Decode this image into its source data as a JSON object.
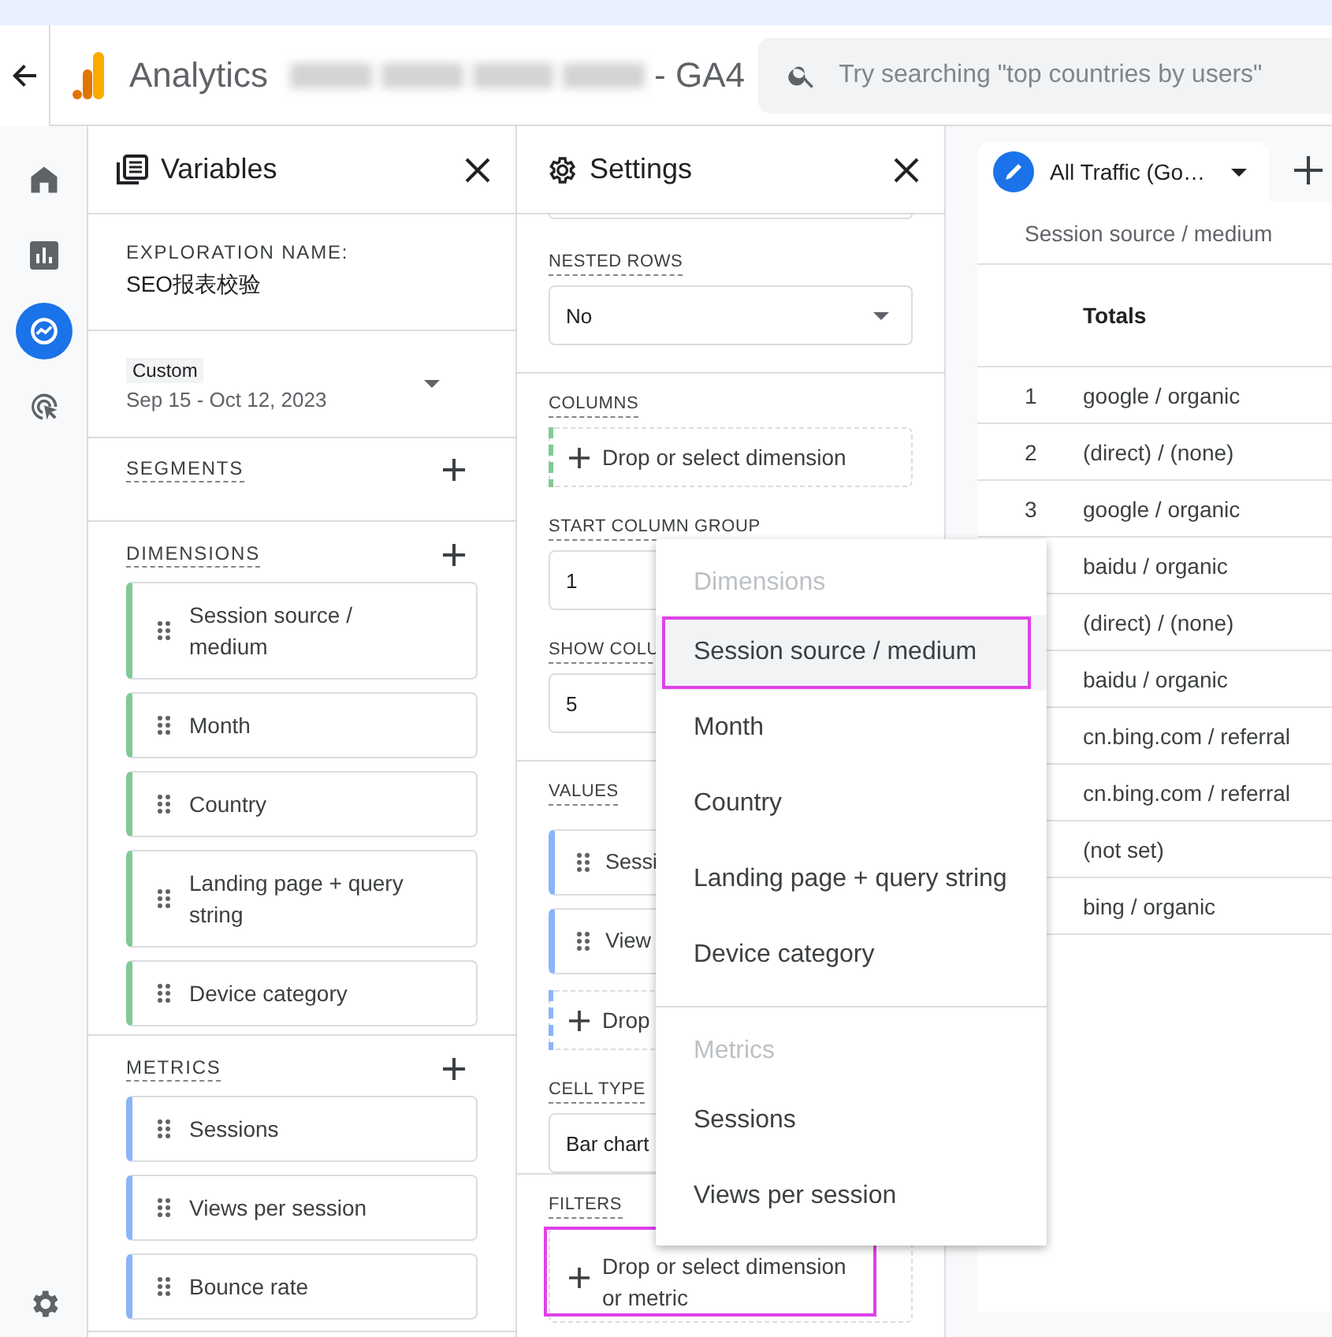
{
  "top_bar": {
    "app_name": "Analytics",
    "property_suffix": "- GA4",
    "search": {
      "placeholder": "Try searching \"top countries by users\""
    }
  },
  "nav_rail": [
    {
      "kind": "home",
      "selected": false
    },
    {
      "kind": "reports",
      "selected": false
    },
    {
      "kind": "explore",
      "selected": true
    },
    {
      "kind": "advertising",
      "selected": false
    }
  ],
  "variables": {
    "title": "Variables",
    "exploration_name_label": "EXPLORATION NAME:",
    "exploration_name": "SEO报表校验",
    "date_range": {
      "label": "Custom",
      "value": "Sep 15 - Oct 12, 2023"
    },
    "segments": {
      "title": "SEGMENTS"
    },
    "dimensions": {
      "title": "DIMENSIONS",
      "items": [
        "Session source / medium",
        "Month",
        "Country",
        "Landing page + query string",
        "Device category"
      ]
    },
    "metrics": {
      "title": "METRICS",
      "items": [
        "Sessions",
        "Views per session",
        "Bounce rate"
      ]
    }
  },
  "settings": {
    "title": "Settings",
    "groups": [
      [
        {
          "label": "NESTED ROWS",
          "kind": "select",
          "value": "No"
        }
      ],
      [
        {
          "label": "COLUMNS",
          "kind": "drop",
          "text": "Drop or select dimension",
          "color": "#81c995",
          "annotated": false
        },
        {
          "label": "START COLUMN GROUP",
          "kind": "field",
          "value": "1"
        },
        {
          "label": "SHOW COLU",
          "kind": "field",
          "value": "5"
        }
      ],
      [
        {
          "label": "VALUES",
          "kind": "chips",
          "items": [
            "Sessi",
            "View"
          ],
          "color": "#8ab4f8"
        },
        {
          "kind": "drop",
          "text": "Drop",
          "color": "#8ab4f8",
          "annotated": false
        },
        {
          "label": "CELL TYPE",
          "kind": "field",
          "value": "Bar chart"
        }
      ],
      [
        {
          "label": "FILTERS",
          "kind": "drop",
          "text": "Drop or select dimension or metric",
          "annotated": true
        }
      ]
    ]
  },
  "menu": {
    "sections": [
      {
        "title": "Dimensions",
        "items": [
          {
            "label": "Session source / medium",
            "selected": true,
            "annotated": true
          },
          {
            "label": "Month",
            "selected": false,
            "annotated": false
          },
          {
            "label": "Country",
            "selected": false,
            "annotated": false
          },
          {
            "label": "Landing page + query string",
            "selected": false,
            "annotated": false
          },
          {
            "label": "Device category",
            "selected": false,
            "annotated": false
          }
        ]
      },
      {
        "title": "Metrics",
        "items": [
          {
            "label": "Sessions",
            "selected": false,
            "annotated": false
          },
          {
            "label": "Views per session",
            "selected": false,
            "annotated": false
          }
        ]
      }
    ]
  },
  "tabs": [
    {
      "label": "All Traffic (Go…",
      "selected": true
    }
  ],
  "table": {
    "row_dimension": "Session source / medium",
    "totals_label": "Totals",
    "rows": [
      {
        "index": "1",
        "value": "google / organic"
      },
      {
        "index": "2",
        "value": "(direct) / (none)"
      },
      {
        "index": "3",
        "value": "google / organic"
      },
      {
        "value": "baidu / organic"
      },
      {
        "value": "(direct) / (none)"
      },
      {
        "value": "baidu / organic"
      },
      {
        "value": "cn.bing.com / referral"
      },
      {
        "value": "cn.bing.com / referral"
      },
      {
        "value": "(not set)"
      },
      {
        "value": "bing / organic"
      }
    ]
  }
}
